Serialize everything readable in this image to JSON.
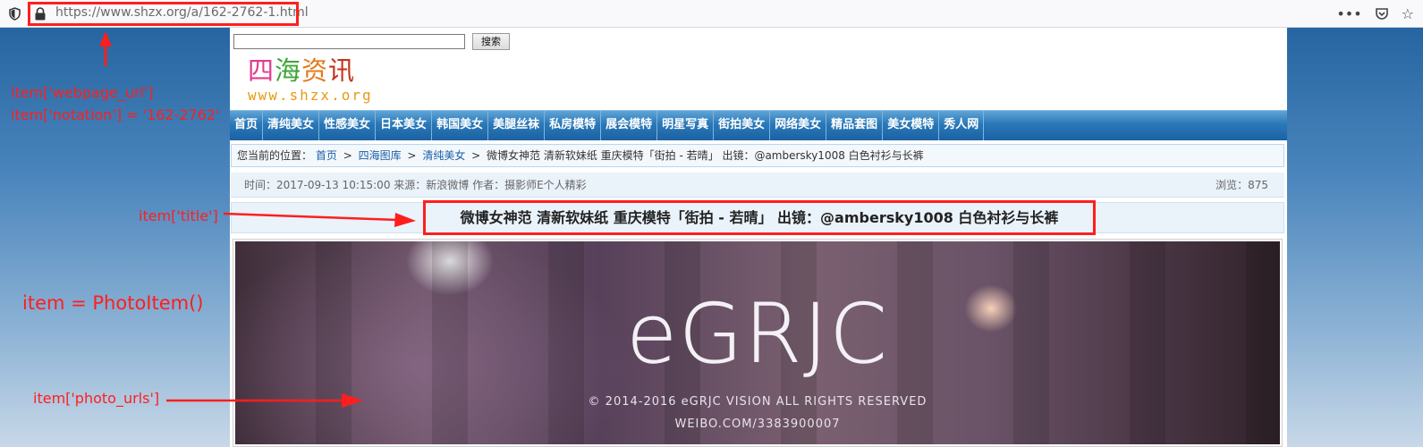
{
  "browser": {
    "url": "https://www.shzx.org/a/162-2762-1.html",
    "icons": [
      "shield-icon",
      "lock-icon",
      "more-icon",
      "pocket-icon",
      "star-icon"
    ]
  },
  "page": {
    "search": {
      "value": "",
      "button_label": "搜索"
    },
    "logo": {
      "title_chars": [
        "四",
        "海",
        "资",
        "讯"
      ],
      "domain": "www.shzx.org"
    },
    "nav": {
      "items": [
        "首页",
        "清纯美女",
        "性感美女",
        "日本美女",
        "韩国美女",
        "美腿丝袜",
        "私房模特",
        "展会模特",
        "明星写真",
        "街拍美女",
        "网络美女",
        "精品套图",
        "美女模特",
        "秀人网"
      ]
    },
    "breadcrumb": {
      "prefix": "您当前的位置：",
      "links": [
        "首页",
        "四海图库",
        "清纯美女"
      ],
      "separator": ">",
      "current": "微博女神范 清新软妹纸 重庆模特「街拍 - 若晴」 出镜：@ambersky1008 白色衬衫与长裤"
    },
    "meta": {
      "info": "时间：2017-09-13 10:15:00  来源：新浪微博  作者：摄影师E个人精彩",
      "views": "浏览：875"
    },
    "article": {
      "title": "微博女神范 清新软妹纸 重庆模特「街拍 - 若晴」 出镜：@ambersky1008 白色衬衫与长裤"
    },
    "photo": {
      "logo": "eGRJC",
      "copyright": "© 2014-2016 eGRJC VISION ALL RIGHTS RESERVED",
      "weibo": "WEIBO.COM/3383900007"
    }
  },
  "annotations": {
    "url_line1": "item['webpage_url']",
    "url_line2": "item['notation'] = '162-2762'",
    "title": "item['title']",
    "item": "item = PhotoItem()",
    "photo_urls": "item['photo_urls']",
    "color": "#ff1e1e"
  }
}
